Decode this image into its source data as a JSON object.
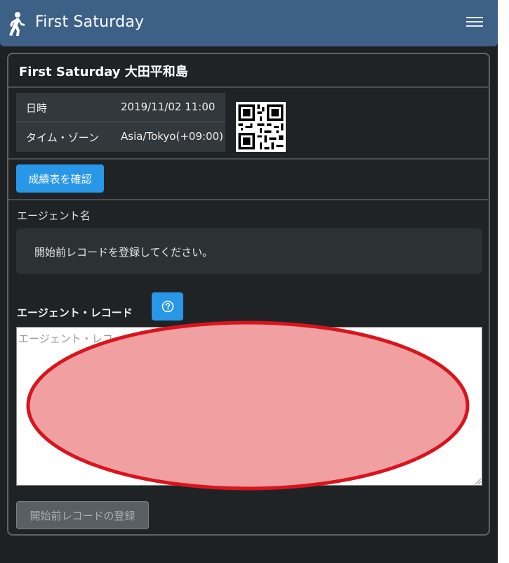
{
  "navbar": {
    "title": "First Saturday",
    "brand_icon": "walking-person-icon",
    "menu_icon": "hamburger-menu-icon"
  },
  "event": {
    "title": "First Saturday 大田平和島",
    "rows": [
      {
        "label": "日時",
        "value": "2019/11/02 11:00"
      },
      {
        "label": "タイム・ゾーン",
        "value": "Asia/Tokyo(+09:00)"
      }
    ],
    "qr_icon": "qr-code-icon"
  },
  "actions": {
    "results_label": "成績表を確認",
    "submit_label": "開始前レコードの登録"
  },
  "agent": {
    "name_label": "エージェント名",
    "notice": "開始前レコードを登録してください。"
  },
  "record": {
    "label": "エージェント・レコード",
    "help_icon": "question-circle-icon",
    "placeholder": "エージェント・レコードをここに貼り付けてください",
    "value": ""
  },
  "colors": {
    "navbar": "#3d6087",
    "primary": "#2997e8",
    "annotation_fill": "#f0a0a0",
    "annotation_stroke": "#d8141e"
  }
}
